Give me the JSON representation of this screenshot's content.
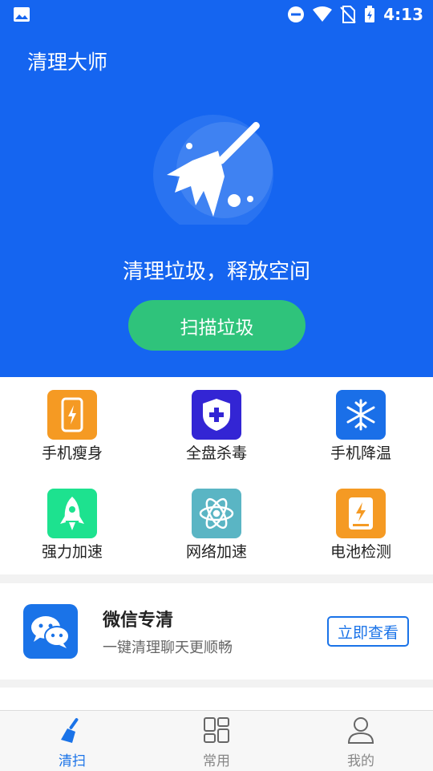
{
  "status_bar": {
    "time": "4:13"
  },
  "header": {
    "title": "清理大师"
  },
  "hero": {
    "slogan": "清理垃圾，释放空间",
    "scan_button": "扫描垃圾"
  },
  "tools": [
    {
      "label": "手机瘦身",
      "icon": "phone-charge-icon",
      "color": "#f59a23"
    },
    {
      "label": "全盘杀毒",
      "icon": "shield-plus-icon",
      "color": "#3325d4"
    },
    {
      "label": "手机降温",
      "icon": "snowflake-icon",
      "color": "#1a6fe8"
    },
    {
      "label": "强力加速",
      "icon": "rocket-icon",
      "color": "#1de28f"
    },
    {
      "label": "网络加速",
      "icon": "atom-icon",
      "color": "#5ab5c4"
    },
    {
      "label": "电池检测",
      "icon": "battery-icon",
      "color": "#f59a23"
    }
  ],
  "wechat_card": {
    "title": "微信专清",
    "subtitle": "一键清理聊天更顺畅",
    "button": "立即查看",
    "icon": "wechat-icon"
  },
  "bottom_nav": [
    {
      "label": "清扫",
      "icon": "broom-icon",
      "active": true
    },
    {
      "label": "常用",
      "icon": "grid-icon",
      "active": false
    },
    {
      "label": "我的",
      "icon": "user-icon",
      "active": false
    }
  ],
  "colors": {
    "primary": "#1565f0",
    "accent_green": "#2fc37b",
    "link_blue": "#1a73e8"
  }
}
